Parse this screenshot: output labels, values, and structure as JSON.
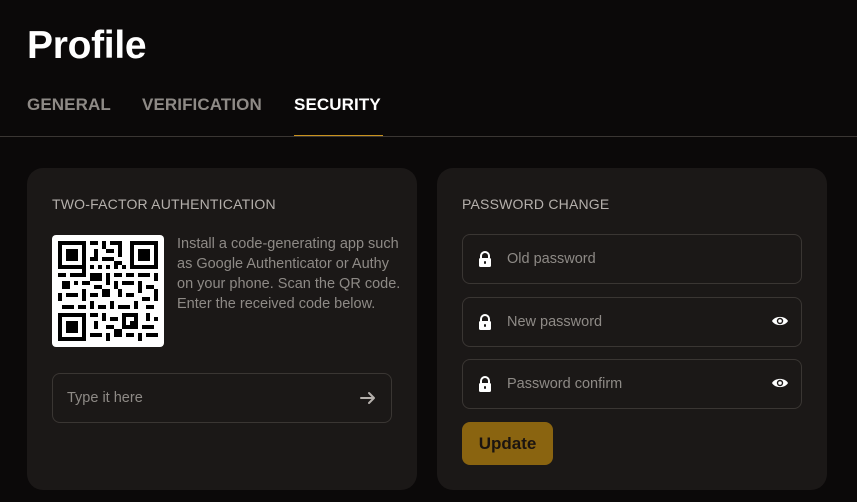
{
  "page": {
    "title": "Profile"
  },
  "tabs": [
    {
      "label": "GENERAL",
      "active": false
    },
    {
      "label": "VERIFICATION",
      "active": false
    },
    {
      "label": "SECURITY",
      "active": true
    }
  ],
  "two_factor": {
    "heading": "TWO-FACTOR AUTHENTICATION",
    "instructions": "Install a code-generating app such as Google Authenticator or Authy on your phone. Scan the QR code. Enter the received code below.",
    "code_placeholder": "Type it here",
    "submit_icon": "arrow-right-icon"
  },
  "password_change": {
    "heading": "PASSWORD CHANGE",
    "old_placeholder": "Old password",
    "new_placeholder": "New password",
    "confirm_placeholder": "Password confirm",
    "update_label": "Update",
    "field_icon": "lock-icon",
    "toggle_icon": "eye-icon"
  },
  "colors": {
    "background": "#0b0909",
    "card": "#1b1817",
    "accent": "#c9921e",
    "button": "#8a6410",
    "muted_text": "#8e8a86"
  }
}
